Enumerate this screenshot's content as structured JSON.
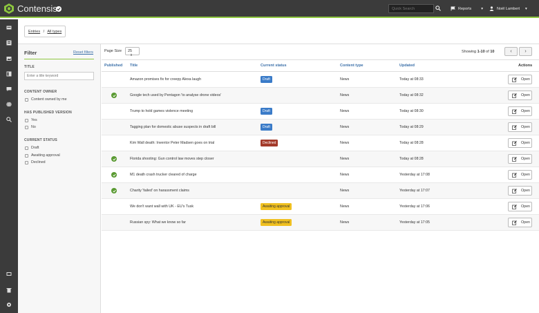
{
  "app": {
    "brand": "Contensis",
    "quick_search_placeholder": "Quick Search",
    "reports_label": "Reports",
    "user_name": "Noël Lambert"
  },
  "breadcrumb": {
    "entries": "Entries",
    "separator": "/",
    "all_types": "All types"
  },
  "filter": {
    "heading": "Filter",
    "reset_label": "Reset filters",
    "title_section": "TITLE",
    "title_placeholder": "Enter a title keyword",
    "owner_section": "CONTENT OWNER",
    "owner_option": "Content owned by me",
    "published_section": "HAS PUBLISHED VERSION",
    "published_yes": "Yes",
    "published_no": "No",
    "status_section": "CURRENT STATUS",
    "status_draft": "Draft",
    "status_awaiting": "Awaiting approval",
    "status_declined": "Declined"
  },
  "list": {
    "page_size_label": "Page Size",
    "page_size_value": "25",
    "showing_prefix": "Showing ",
    "showing_range": "1-10",
    "showing_of": " of ",
    "showing_total": "10",
    "prev": "‹",
    "next": "›",
    "columns": {
      "published": "Published",
      "title": "Title",
      "status": "Current status",
      "type": "Content type",
      "updated": "Updated",
      "actions": "Actions"
    },
    "open_label": "Open",
    "rows": [
      {
        "published": false,
        "title": "Amazon promises fix for creepy Alexa laugh",
        "status": "Draft",
        "type": "News",
        "updated": "Today at 08:33"
      },
      {
        "published": true,
        "title": "Google tech used by Pentagon 'to analyse drone videos'",
        "status": "",
        "type": "News",
        "updated": "Today at 08:32"
      },
      {
        "published": false,
        "title": "Trump to hold games violence meeting",
        "status": "Draft",
        "type": "News",
        "updated": "Today at 08:30"
      },
      {
        "published": false,
        "title": "Tagging plan for domestic abuse suspects in draft bill",
        "status": "Draft",
        "type": "News",
        "updated": "Today at 08:29"
      },
      {
        "published": false,
        "title": "Kim Wall death: Inventor Peter Madsen goes on trial",
        "status": "Declined",
        "type": "News",
        "updated": "Today at 08:28"
      },
      {
        "published": true,
        "title": "Florida shooting: Gun control law moves step closer",
        "status": "",
        "type": "News",
        "updated": "Today at 08:28"
      },
      {
        "published": true,
        "title": "M1 death crash trucker cleared of charge",
        "status": "",
        "type": "News",
        "updated": "Yesterday at 17:08"
      },
      {
        "published": true,
        "title": "Charity 'failed' on harassment claims",
        "status": "",
        "type": "News",
        "updated": "Yesterday at 17:07"
      },
      {
        "published": false,
        "title": "We don't want wall with UK - EU's Tusk",
        "status": "Awaiting approval",
        "type": "News",
        "updated": "Yesterday at 17:06"
      },
      {
        "published": false,
        "title": "Russian spy: What we know so far",
        "status": "Awaiting approval",
        "type": "News",
        "updated": "Yesterday at 17:05"
      }
    ]
  },
  "colors": {
    "accent": "#8dc63f",
    "nav_bg": "#3b3b3b",
    "link": "#3a6fa8",
    "draft": "#3a7bc8",
    "declined": "#a33a2a",
    "awaiting": "#f0c020",
    "published": "#5a9a32"
  }
}
